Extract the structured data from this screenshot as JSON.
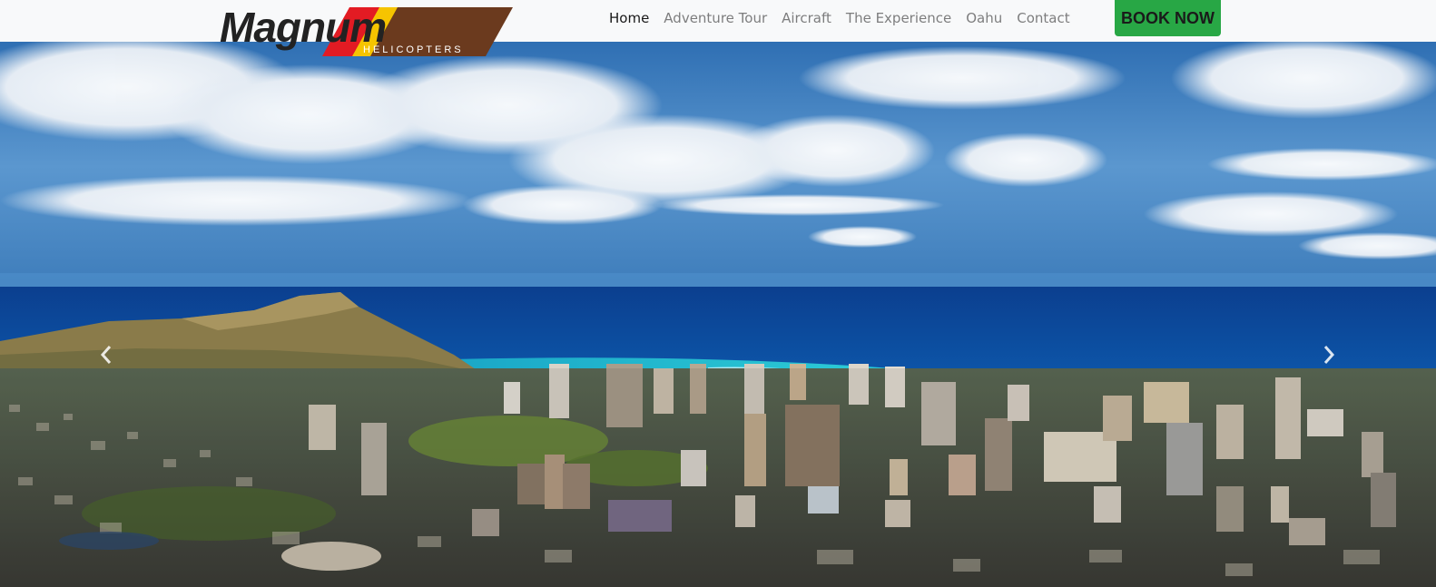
{
  "brand": {
    "name": "Magnum",
    "tagline": "HELICOPTERS",
    "colors": {
      "dark": "#222222",
      "red": "#e31b23",
      "yellow": "#f6c400",
      "brown": "#6b3a1e"
    }
  },
  "nav": {
    "items": [
      {
        "label": "Home",
        "active": true
      },
      {
        "label": "Adventure Tour",
        "active": false
      },
      {
        "label": "Aircraft",
        "active": false
      },
      {
        "label": "The Experience",
        "active": false
      },
      {
        "label": "Oahu",
        "active": false
      },
      {
        "label": "Contact",
        "active": false
      }
    ],
    "cta": "BOOK NOW"
  },
  "hero": {
    "image": "aerial-view-honolulu-diamond-head",
    "prev_icon": "chevron-left-icon",
    "next_icon": "chevron-right-icon"
  },
  "colors": {
    "navbar_bg": "#f8f9fa",
    "cta_green": "#28a745",
    "sky_blue": "#3f86c8",
    "ocean_deep": "#0d4fa3",
    "ocean_turquoise": "#19b9c9"
  }
}
